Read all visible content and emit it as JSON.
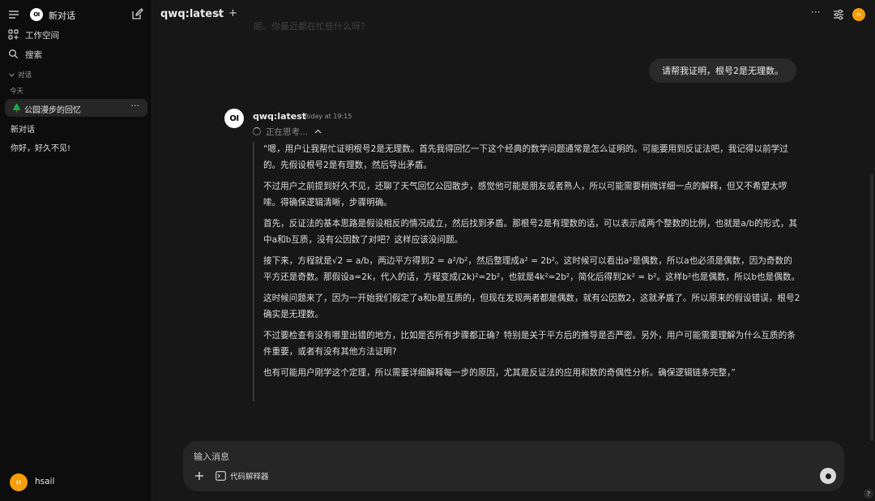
{
  "sidebar": {
    "new_chat_label": "新对话",
    "logo_text": "OI",
    "workspace_label": "工作空间",
    "search_label": "搜索",
    "section_label": "对话",
    "group_today": "今天",
    "conversations": [
      {
        "label": "公园漫步的回忆",
        "active": true
      },
      {
        "label": "新对话",
        "active": false
      },
      {
        "label": "你好，好久不见!",
        "active": false
      }
    ],
    "more_label": "···",
    "user": {
      "initial": "H",
      "name": "hsail"
    }
  },
  "topbar": {
    "model_name": "qwq:latest",
    "plus": "+",
    "more": "···",
    "avatar_initial": "H"
  },
  "chat": {
    "faded_previous": "呢。你最近都在忙些什么呀?",
    "user_message": "请帮我证明，根号2是无理数。",
    "assistant": {
      "logo_text": "OI",
      "name": "qwq:latest",
      "time": "Today at 19:15",
      "thinking": "正在思考...",
      "paragraphs": [
        "“嗯，用户让我帮忙证明根号2是无理数。首先我得回忆一下这个经典的数学问题通常是怎么证明的。可能要用到反证法吧，我记得以前学过的。先假设根号2是有理数，然后导出矛盾。",
        "不过用户之前提到好久不见，还聊了天气回忆公园散步，感觉他可能是朋友或者熟人，所以可能需要稍微详细一点的解释，但又不希望太啰嗦。得确保逻辑清晰，步骤明确。",
        "首先，反证法的基本思路是假设相反的情况成立，然后找到矛盾。那根号2是有理数的话，可以表示成两个整数的比例，也就是a/b的形式，其中a和b互质，没有公因数了对吧？这样应该没问题。",
        "接下来，方程就是√2 = a/b，两边平方得到2 = a²/b²，然后整理成a² = 2b²。这时候可以看出a²是偶数，所以a也必须是偶数，因为奇数的平方还是奇数。那假设a=2k，代入的话，方程变成(2k)²=2b²，也就是4k²=2b²，简化后得到2k² = b²。这样b²也是偶数，所以b也是偶数。",
        "这时候问题来了，因为一开始我们假定了a和b是互质的，但现在发现两者都是偶数，就有公因数2，这就矛盾了。所以原来的假设错误，根号2确实是无理数。",
        "不过要检查有没有哪里出错的地方，比如是否所有步骤都正确？特别是关于平方后的推导是否严密。另外，用户可能需要理解为什么互质的条件重要，或者有没有其他方法证明?",
        "也有可能用户刚学这个定理，所以需要详细解释每一步的原因，尤其是反证法的应用和数的奇偶性分析。确保逻辑链条完整，”"
      ]
    }
  },
  "composer": {
    "placeholder": "输入消息",
    "plus": "+",
    "code_interpreter_label": "代码解释器"
  },
  "help": "?",
  "colors": {
    "accent": "#f59e0b",
    "background": "#171717",
    "sidebar": "#0d0d0d",
    "bubble": "#2a2a2a"
  }
}
